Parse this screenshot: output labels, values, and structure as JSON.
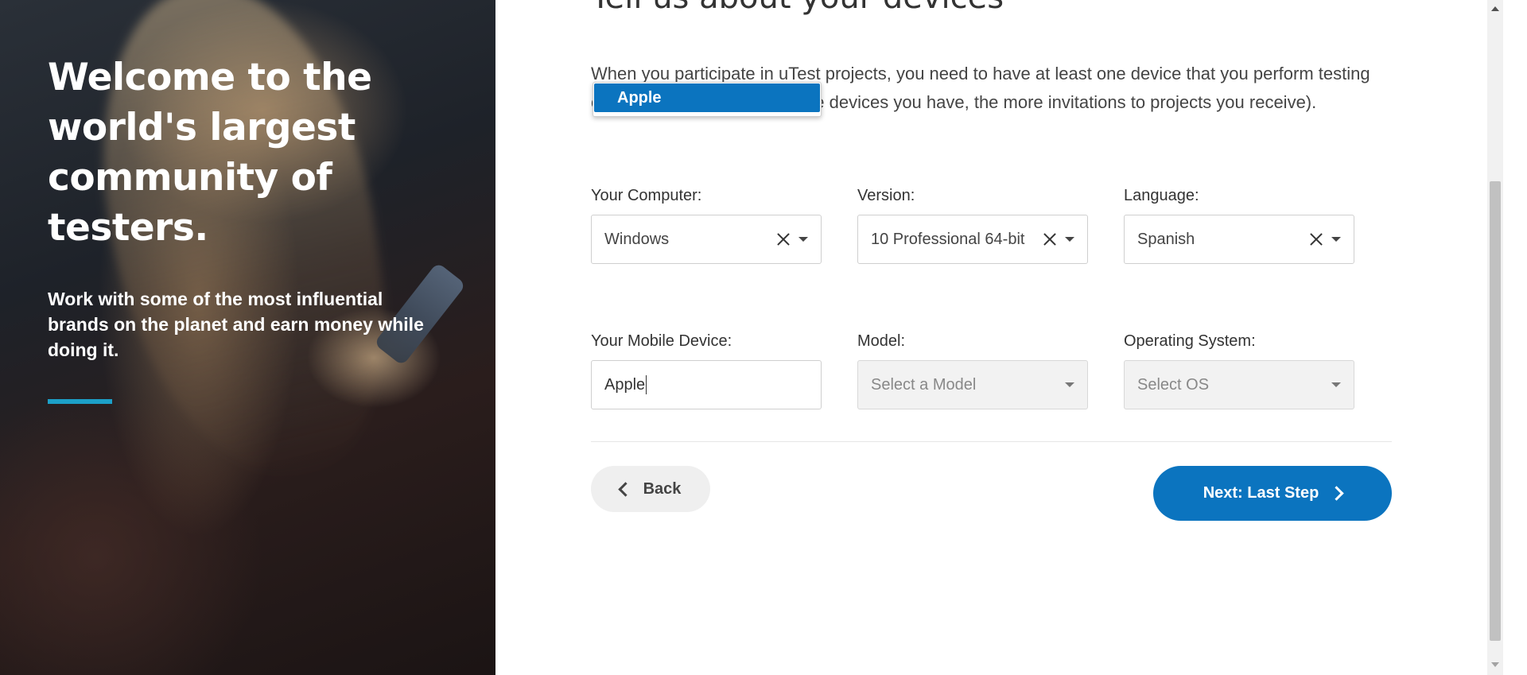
{
  "hero": {
    "title": "Welcome to the world's largest community of testers.",
    "subtitle": "Work with some of the most influential brands on the planet and earn money while doing it.",
    "accent_color": "#1ca0c8"
  },
  "form": {
    "heading": "Tell us about your devices",
    "intro": "When you participate in uTest projects, you need to have at least one device that you perform testing on. Add your device (the more devices you have, the more invitations to projects you receive).",
    "computer": {
      "label": "Your Computer:",
      "value": "Windows"
    },
    "version": {
      "label": "Version:",
      "value": "10 Professional 64-bit"
    },
    "language": {
      "label": "Language:",
      "value": "Spanish"
    },
    "mobile": {
      "label": "Your Mobile Device:",
      "value": "Apple"
    },
    "model": {
      "label": "Model:",
      "placeholder": "Select a Model"
    },
    "os": {
      "label": "Operating System:",
      "placeholder": "Select OS"
    },
    "dropdown": {
      "items": [
        "Apple"
      ]
    },
    "back_label": "Back",
    "next_label": "Next: Last Step",
    "primary_color": "#0b74bf"
  }
}
